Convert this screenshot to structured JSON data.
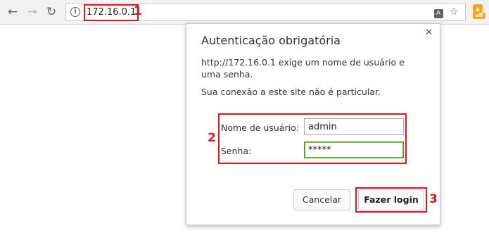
{
  "browser": {
    "url": "172.16.0.1",
    "icons": {
      "back": "back-arrow-icon",
      "forward": "forward-arrow-icon",
      "reload": "reload-icon",
      "info": "info-icon",
      "translate": "translate-icon",
      "star": "star-icon",
      "extension": "extension-off-icon"
    },
    "extension_badge": "off"
  },
  "callouts": {
    "one": "1",
    "two": "2",
    "three": "3"
  },
  "dialog": {
    "title": "Autenticação obrigatória",
    "message": "http://172.16.0.1 exige um nome de usuário e uma senha.",
    "privacy_note": "Sua conexão a este site não é particular.",
    "username_label": "Nome de usuário:",
    "username_value": "admin",
    "password_label": "Senha:",
    "password_value": "*****",
    "cancel_label": "Cancelar",
    "login_label": "Fazer login"
  },
  "colors": {
    "highlight": "#e3121a",
    "focus_border": "#4e9a06"
  }
}
